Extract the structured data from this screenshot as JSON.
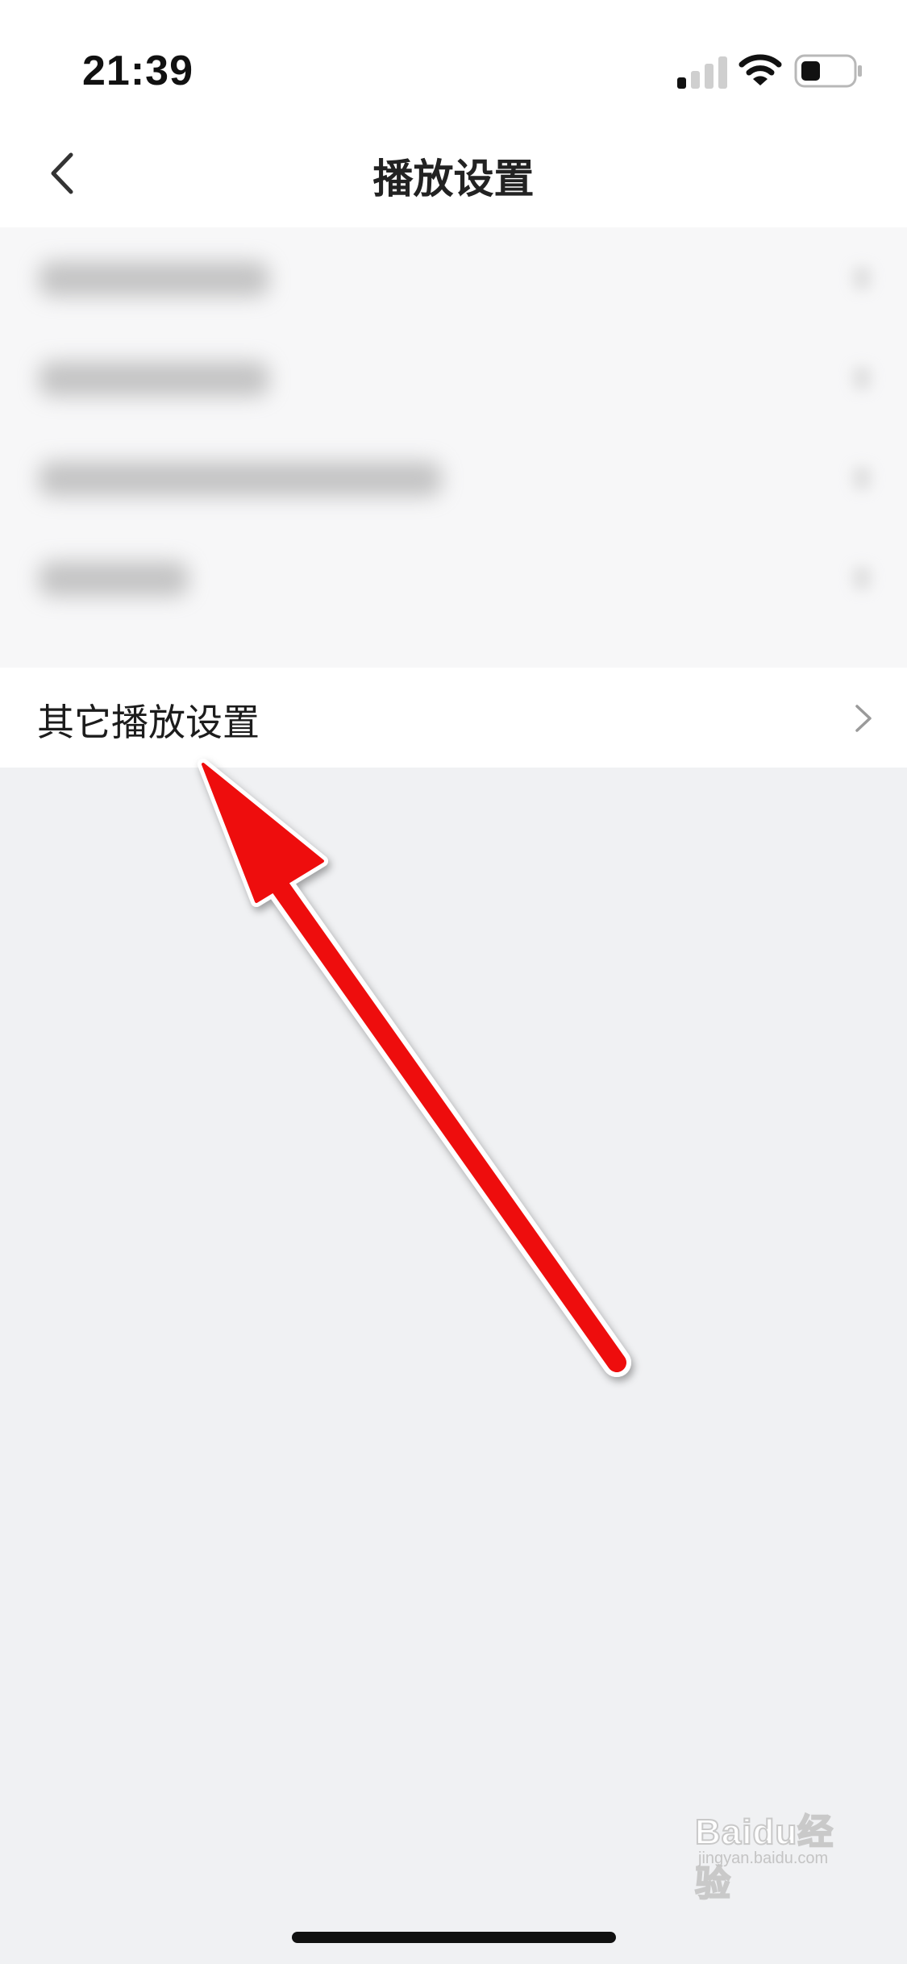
{
  "status_bar": {
    "time": "21:39",
    "icons": [
      "cellular-signal-icon",
      "wifi-icon",
      "battery-icon"
    ]
  },
  "nav": {
    "title": "播放设置",
    "back_icon": "chevron-left-icon"
  },
  "list": {
    "obscured_items_count": 4,
    "visible_item": {
      "label": "其它播放设置",
      "icon": "chevron-right-icon"
    }
  },
  "annotation": {
    "arrow_color": "#ee1111"
  },
  "watermark": {
    "text": "Baidu经验",
    "subtext": "jingyan.baidu.com"
  },
  "colors": {
    "page_background": "#f0f1f3",
    "surface": "#ffffff",
    "text_primary": "#1c1c1c",
    "chevron": "#9a9a9a"
  }
}
